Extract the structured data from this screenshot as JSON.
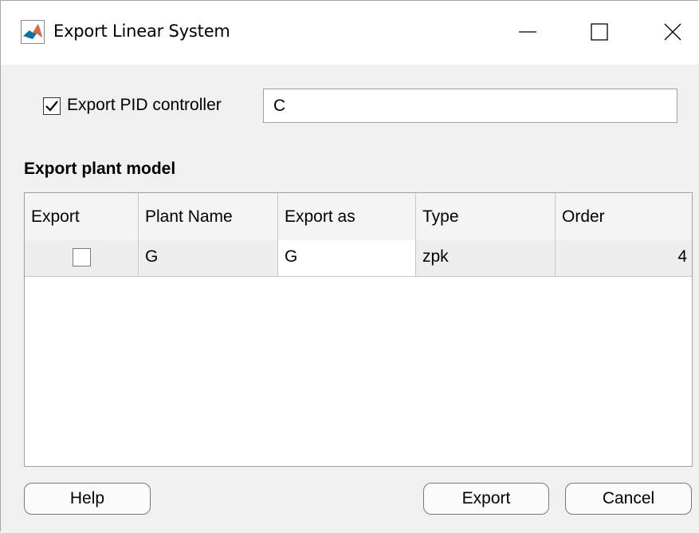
{
  "window": {
    "title": "Export Linear System",
    "icon": "matlab-icon",
    "minimize_icon": "minimize-icon",
    "maximize_icon": "maximize-icon",
    "close_icon": "close-icon"
  },
  "pid": {
    "label": "Export PID controller",
    "checked": true,
    "value": "C"
  },
  "plant": {
    "section_title": "Export plant model",
    "columns": [
      "Export",
      "Plant Name",
      "Export as",
      "Type",
      "Order"
    ],
    "rows": [
      {
        "export": false,
        "plant_name": "G",
        "export_as": "G",
        "type": "zpk",
        "order": "4"
      }
    ]
  },
  "buttons": {
    "help": "Help",
    "export": "Export",
    "cancel": "Cancel"
  },
  "colors": {
    "window_bg": "#f0f0f0",
    "titlebar_bg": "#ffffff",
    "header_bg": "#f4f4f4",
    "readonly_cell_bg": "#ededed"
  }
}
